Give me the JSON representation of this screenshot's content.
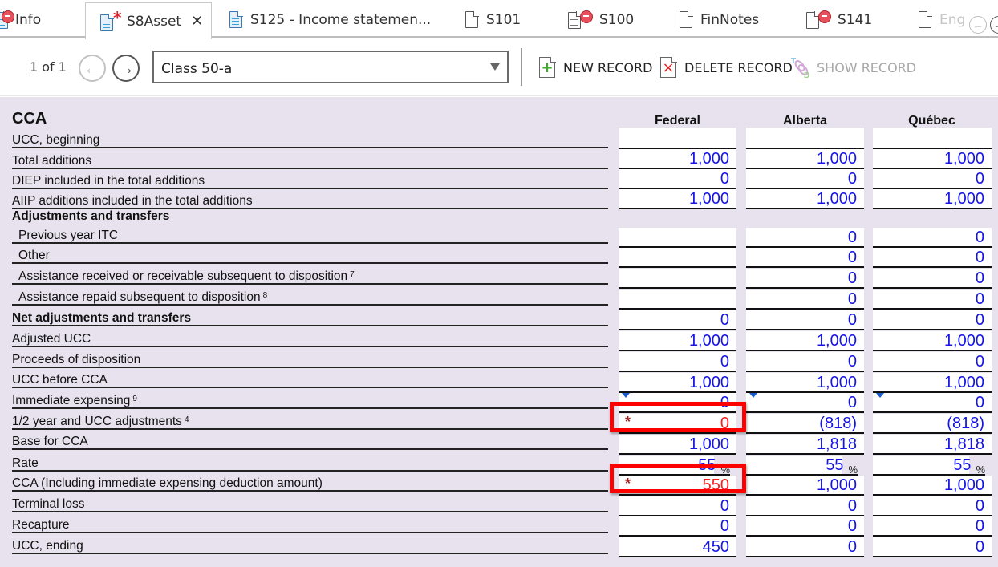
{
  "tabs": [
    {
      "label": "Info",
      "icon": "document-error-icon",
      "active": false
    },
    {
      "label": "S8Asset",
      "icon": "document-modified-icon",
      "active": true,
      "close_label": "✕"
    },
    {
      "label": "S125 - Income statemen...",
      "icon": "document-icon",
      "active": false
    },
    {
      "label": "S101",
      "icon": "blank-document-icon",
      "active": false
    },
    {
      "label": "S100",
      "icon": "document-error-icon",
      "active": false
    },
    {
      "label": "FinNotes",
      "icon": "blank-document-icon",
      "active": false
    },
    {
      "label": "S141",
      "icon": "document-error-icon",
      "active": false
    },
    {
      "label": "Eng",
      "icon": "blank-document-icon",
      "active": false
    }
  ],
  "toolbar": {
    "record_count": "1 of 1",
    "prev_label": "←",
    "next_label": "→",
    "record_select": {
      "value": "Class 50-a"
    },
    "new_record_label": "NEW RECORD",
    "delete_record_label": "DELETE RECORD",
    "show_record_label": "SHOW RECORD"
  },
  "form": {
    "title": "CCA",
    "columns": [
      "Federal",
      "Alberta",
      "Québec"
    ],
    "rows": [
      {
        "label": "UCC, beginning",
        "values": [
          "",
          "",
          ""
        ]
      },
      {
        "label": "Total additions",
        "values": [
          "1,000",
          "1,000",
          "1,000"
        ]
      },
      {
        "label": "DIEP included in the total additions",
        "values": [
          "0",
          "0",
          "0"
        ]
      },
      {
        "label": "AIIP additions included in the total additions",
        "values": [
          "1,000",
          "1,000",
          "1,000"
        ]
      },
      {
        "label": "Adjustments and transfers",
        "section": true
      },
      {
        "label": "Previous year ITC",
        "values": [
          "",
          "0",
          "0"
        ]
      },
      {
        "label": "Other",
        "values": [
          "",
          "0",
          "0"
        ]
      },
      {
        "label": "Assistance received or receivable subsequent to disposition",
        "footnote": "7",
        "values": [
          "",
          "0",
          "0"
        ]
      },
      {
        "label": "Assistance repaid subsequent to disposition",
        "footnote": "8",
        "values": [
          "",
          "0",
          "0"
        ]
      },
      {
        "label": "Net adjustments and transfers",
        "values": [
          "0",
          "0",
          "0"
        ]
      },
      {
        "label": "Adjusted UCC",
        "values": [
          "1,000",
          "1,000",
          "1,000"
        ]
      },
      {
        "label": "Proceeds of disposition",
        "values": [
          "0",
          "0",
          "0"
        ]
      },
      {
        "label": "UCC before CCA",
        "values": [
          "1,000",
          "1,000",
          "1,000"
        ]
      },
      {
        "label": "Immediate expensing",
        "footnote": "9",
        "values": [
          "0",
          "0",
          "0"
        ]
      },
      {
        "label": "1/2 year and UCC adjustments",
        "footnote": "4",
        "values": [
          "0",
          "(818)",
          "(818)"
        ]
      },
      {
        "label": "Base for CCA",
        "values": [
          "1,000",
          "1,818",
          "1,818"
        ]
      },
      {
        "label": "Rate",
        "values": [
          "55",
          "55",
          "55"
        ],
        "unit": "%"
      },
      {
        "label": "CCA (Including immediate expensing deduction amount)",
        "values": [
          "550",
          "1,000",
          "1,000"
        ]
      },
      {
        "label": "Terminal loss",
        "values": [
          "0",
          "0",
          "0"
        ]
      },
      {
        "label": "Recapture",
        "values": [
          "0",
          "0",
          "0"
        ]
      },
      {
        "label": "UCC, ending",
        "values": [
          "450",
          "0",
          "0"
        ]
      }
    ],
    "overridden_marker": "*"
  },
  "colors": {
    "value_text": "#1414e6",
    "override_text": "#ff1a1a",
    "highlight_box": "#ff0000",
    "form_background": "#e8e2ee"
  }
}
